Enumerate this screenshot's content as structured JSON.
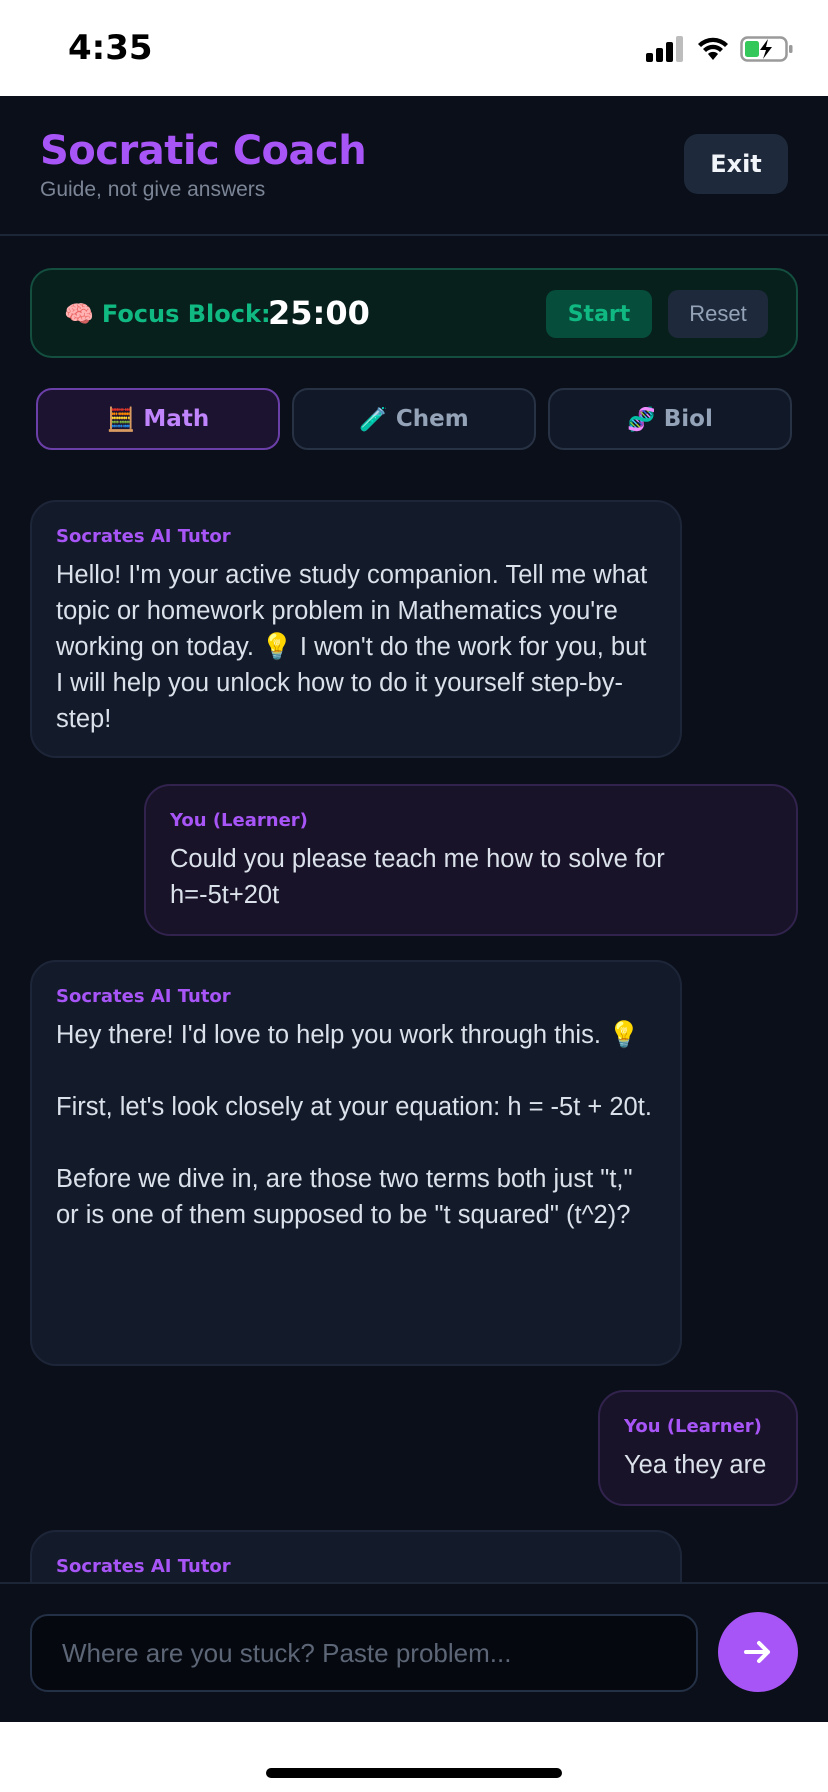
{
  "status_bar": {
    "time": "4:35"
  },
  "header": {
    "title": "Socratic Coach",
    "subtitle": "Guide, not give answers",
    "exit_label": "Exit"
  },
  "focus": {
    "icon": "brain-emoji",
    "label": "Focus Block:",
    "time": "25:00",
    "start_label": "Start",
    "reset_label": "Reset"
  },
  "subjects": [
    {
      "icon": "abacus-emoji",
      "label": "Math",
      "active": true
    },
    {
      "icon": "test-tube-emoji",
      "label": "Chem",
      "active": false
    },
    {
      "icon": "dna-emoji",
      "label": "Biol",
      "active": false
    }
  ],
  "messages": [
    {
      "sender": "Socrates AI Tutor",
      "role": "tutor",
      "text": "Hello! I'm your active study companion. Tell me what topic or homework problem in Mathematics you're working on today. 💡 I won't do the work for you, but I will help you unlock how to do it yourself step-by-step!"
    },
    {
      "sender": "You (Learner)",
      "role": "learner",
      "text": "Could you please teach me how to solve for h=-5t+20t"
    },
    {
      "sender": "Socrates AI Tutor",
      "role": "tutor",
      "text": "Hey there! I'd love to help you work through this. 💡\n\nFirst, let's look closely at your equation: h = -5t + 20t.\n\nBefore we dive in, are those two terms both just \"t,\" or is one of them supposed to be \"t squared\" (t^2)?"
    },
    {
      "sender": "You (Learner)",
      "role": "learner",
      "text": "Yea they are"
    },
    {
      "sender": "Socrates AI Tutor",
      "role": "tutor",
      "text": ""
    }
  ],
  "composer": {
    "placeholder": "Where are you stuck? Paste problem...",
    "send_icon": "arrow-right-icon"
  },
  "colors": {
    "accent": "#a855f7",
    "focus_green": "#10b981",
    "background": "#0b0f19"
  }
}
